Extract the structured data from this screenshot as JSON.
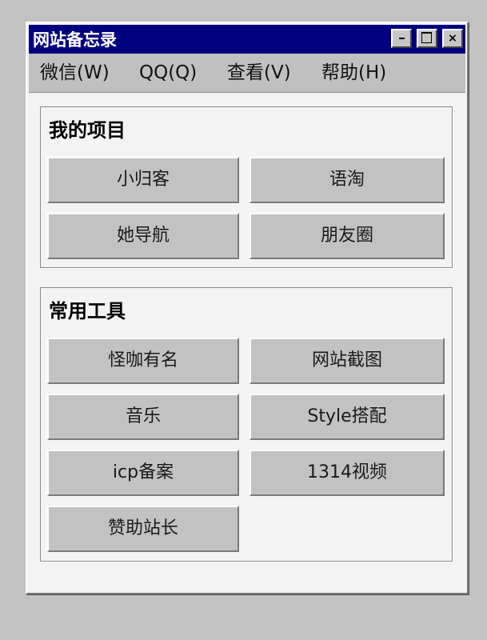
{
  "window": {
    "title": "网站备忘录",
    "buttons": {
      "minimize": "-",
      "maximize": "□",
      "close": "×"
    }
  },
  "menu": {
    "items": [
      {
        "label": "微信(W)"
      },
      {
        "label": "QQ(Q)"
      },
      {
        "label": "查看(V)"
      },
      {
        "label": "帮助(H)"
      }
    ]
  },
  "projects": {
    "title": "我的项目",
    "items": [
      {
        "label": "小归客"
      },
      {
        "label": "语淘"
      },
      {
        "label": "她导航"
      },
      {
        "label": "朋友圈"
      }
    ]
  },
  "tools": {
    "title": "常用工具",
    "items": [
      {
        "label": "怪咖有名"
      },
      {
        "label": "网站截图"
      },
      {
        "label": "音乐"
      },
      {
        "label": "Style搭配"
      },
      {
        "label": "icp备案"
      },
      {
        "label": "1314视频"
      },
      {
        "label": "赞助站长"
      }
    ]
  },
  "colors": {
    "titlebar": "#00007f",
    "desktop": "#c2c2c2",
    "button_face": "#c2c2c2",
    "window_bg": "#f3f3f3"
  }
}
